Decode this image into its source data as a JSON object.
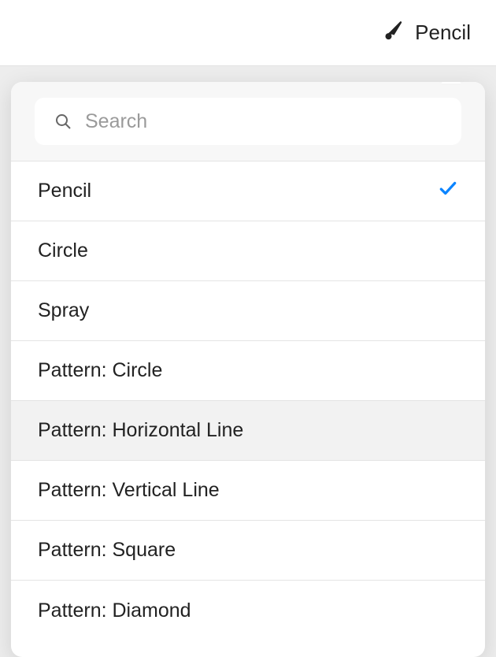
{
  "topbar": {
    "current_tool": "Pencil"
  },
  "search": {
    "placeholder": "Search",
    "value": ""
  },
  "options": [
    {
      "label": "Pencil",
      "selected": true,
      "hover": false
    },
    {
      "label": "Circle",
      "selected": false,
      "hover": false
    },
    {
      "label": "Spray",
      "selected": false,
      "hover": false
    },
    {
      "label": "Pattern: Circle",
      "selected": false,
      "hover": false
    },
    {
      "label": "Pattern: Horizontal Line",
      "selected": false,
      "hover": true
    },
    {
      "label": "Pattern: Vertical Line",
      "selected": false,
      "hover": false
    },
    {
      "label": "Pattern: Square",
      "selected": false,
      "hover": false
    },
    {
      "label": "Pattern: Diamond",
      "selected": false,
      "hover": false
    }
  ]
}
